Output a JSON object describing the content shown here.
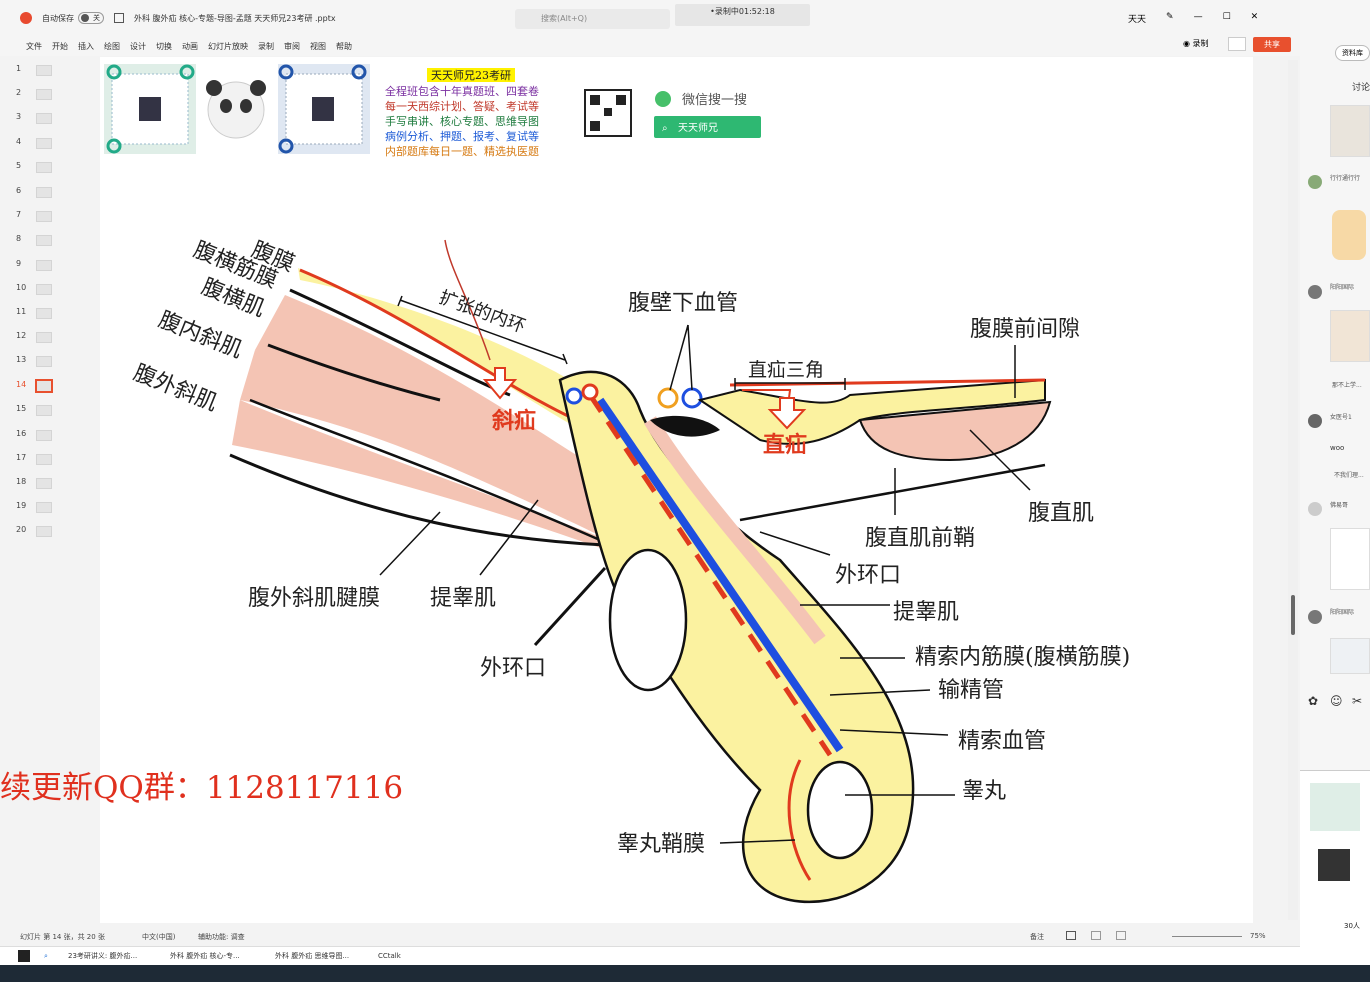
{
  "window": {
    "auto_save": "自动保存",
    "toggle": "关",
    "filename": "外科 腹外疝 核心-专题-导图-孟题 天天师兄23考研 .pptx",
    "search_placeholder": "搜索(Alt+Q)",
    "recording": "•录制中01:52:18",
    "user": "天天"
  },
  "menu": [
    "文件",
    "开始",
    "插入",
    "绘图",
    "设计",
    "切换",
    "动画",
    "幻灯片放映",
    "录制",
    "审阅",
    "视图",
    "帮助"
  ],
  "toolbar": {
    "record": "◉ 录制",
    "share": "共享"
  },
  "thumbnails": [
    "1",
    "2",
    "3",
    "4",
    "5",
    "6",
    "7",
    "8",
    "9",
    "10",
    "11",
    "12",
    "13",
    "14",
    "15",
    "16",
    "17",
    "18",
    "19",
    "20"
  ],
  "active_slide": "14",
  "slide": {
    "header_title": "天天师兄23考研",
    "promo_lines": [
      "全程班包含十年真题班、四套卷",
      "每一天西综计划、答疑、考试等",
      "手写串讲、核心专题、思维导图",
      "病例分析、押题、报考、复试等",
      "内部题库每日一题、精选执医题"
    ],
    "wechat_search": "微信搜一搜",
    "wechat_name": "天天师兄",
    "qq_group": "续更新QQ群：1128117116"
  },
  "diagram_labels": {
    "peritoneum": "腹膜",
    "transversalis_fascia": "腹横筋膜",
    "transversus": "腹横肌",
    "internal_oblique": "腹内斜肌",
    "external_oblique": "腹外斜肌",
    "dilated_ring": "扩张的内环",
    "indirect_hernia": "斜疝",
    "inferior_epigastric": "腹壁下血管",
    "hesselbach": "直疝三角",
    "direct_hernia": "直疝",
    "preperitoneal": "腹膜前间隙",
    "rectus": "腹直肌",
    "rectus_sheath": "腹直肌前鞘",
    "ext_ring_right": "外环口",
    "cremaster_right": "提睾肌",
    "internal_spermatic": "精索内筋膜(腹横筋膜)",
    "vas": "输精管",
    "cord_vessels": "精索血管",
    "testis": "睾丸",
    "tunica_vaginalis": "睾丸鞘膜",
    "ext_aponeurosis": "腹外斜肌腱膜",
    "cremaster_left": "提睾肌",
    "ext_ring_left": "外环口"
  },
  "status": {
    "slide_info": "幻灯片 第 14 张，共 20 张",
    "lang": "中文(中国)",
    "access": "辅助功能: 调查",
    "notes": "备注",
    "zoom": "75%"
  },
  "taskbar": [
    "23考研讲义: 腹外疝...",
    "外科 腹外疝 核心-专...",
    "外科 腹外疝 思维导图...",
    "CCtalk"
  ],
  "chat": {
    "top_button": "资料库",
    "tab": "讨论",
    "messages": [
      "行行通行行",
      "阳阳国际",
      "那不上学...",
      "女医号1",
      "woo",
      "不我们理...",
      "佛易哥",
      "阳阳国际"
    ],
    "viewers": "30人"
  },
  "colors": {
    "accent": "#e8502e",
    "muscle": "#f4c4b4",
    "fat": "#fbf2a0",
    "red_line": "#e03a1e",
    "blue": "#1e4fe0",
    "green_btn": "#2eb872"
  }
}
